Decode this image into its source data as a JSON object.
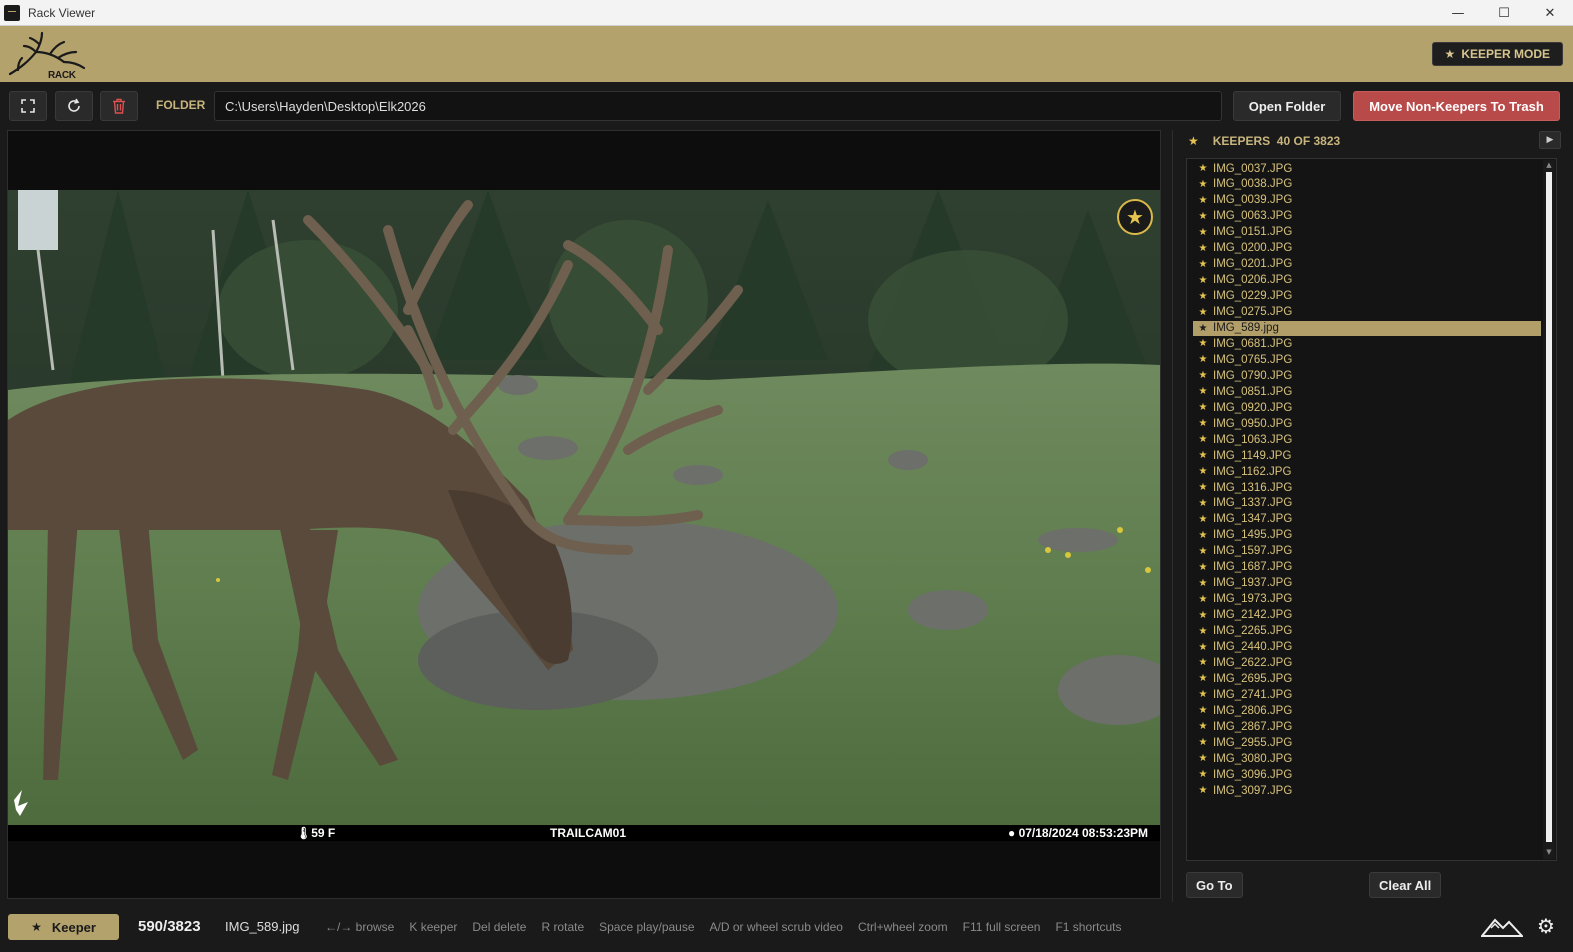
{
  "window": {
    "title": "Rack Viewer",
    "minimize": "—",
    "maximize": "☐",
    "close": "✕"
  },
  "header": {
    "logo_text": "RACK VIEWER",
    "keeper_mode_label": "KEEPER MODE"
  },
  "toolbar": {
    "folder_label": "FOLDER",
    "folder_path": "C:\\Users\\Hayden\\Desktop\\Elk2026",
    "open_folder_label": "Open Folder",
    "move_trash_label": "Move Non-Keepers To Trash"
  },
  "viewer": {
    "temperature": "59 F",
    "camera_name": "TRAILCAM01",
    "datetime": "07/18/2024  08:53:23PM"
  },
  "sidebar": {
    "title": "KEEPERS",
    "count": "40 OF 3823",
    "selected_index": 10,
    "items": [
      "IMG_0037.JPG",
      "IMG_0038.JPG",
      "IMG_0039.JPG",
      "IMG_0063.JPG",
      "IMG_0151.JPG",
      "IMG_0200.JPG",
      "IMG_0201.JPG",
      "IMG_0206.JPG",
      "IMG_0229.JPG",
      "IMG_0275.JPG",
      "IMG_589.jpg",
      "IMG_0681.JPG",
      "IMG_0765.JPG",
      "IMG_0790.JPG",
      "IMG_0851.JPG",
      "IMG_0920.JPG",
      "IMG_0950.JPG",
      "IMG_1063.JPG",
      "IMG_1149.JPG",
      "IMG_1162.JPG",
      "IMG_1316.JPG",
      "IMG_1337.JPG",
      "IMG_1347.JPG",
      "IMG_1495.JPG",
      "IMG_1597.JPG",
      "IMG_1687.JPG",
      "IMG_1937.JPG",
      "IMG_1973.JPG",
      "IMG_2142.JPG",
      "IMG_2265.JPG",
      "IMG_2440.JPG",
      "IMG_2622.JPG",
      "IMG_2695.JPG",
      "IMG_2741.JPG",
      "IMG_2806.JPG",
      "IMG_2867.JPG",
      "IMG_2955.JPG",
      "IMG_3080.JPG",
      "IMG_3096.JPG",
      "IMG_3097.JPG"
    ],
    "goto_label": "Go To",
    "clear_label": "Clear All"
  },
  "bottom": {
    "keeper_label": "Keeper",
    "counter": "590/3823",
    "filename": "IMG_589.jpg",
    "hints": [
      "←/→ browse",
      "K keeper",
      "Del delete",
      "R rotate",
      "Space play/pause",
      "A/D or wheel scrub video",
      "Ctrl+wheel zoom",
      "F11 full screen",
      "F1 shortcuts"
    ]
  },
  "colors": {
    "accent": "#b4a26d",
    "keeper_text": "#d8c27b",
    "danger": "#b84a4a",
    "star": "#e4c44e"
  },
  "icons": {
    "fullscreen": "fullscreen-icon",
    "refresh": "refresh-icon",
    "trash": "trash-icon",
    "star": "star-icon",
    "mountain": "mountain-icon",
    "gear": "gear-icon"
  }
}
